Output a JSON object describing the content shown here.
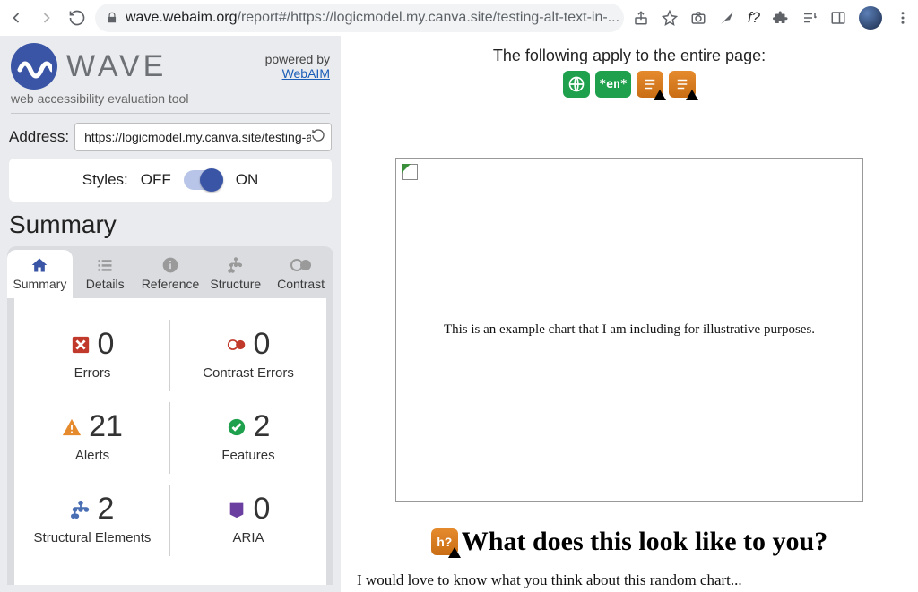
{
  "browser": {
    "url_domain": "wave.webaim.org",
    "url_path": "/report#/https://logicmodel.my.canva.site/testing-alt-text-in-..."
  },
  "sidebar": {
    "brand": "WAVE",
    "powered_label": "powered by",
    "powered_link": "WebAIM",
    "tagline": "web accessibility evaluation tool",
    "address_label": "Address:",
    "address_value": "https://logicmodel.my.canva.site/testing-alt-",
    "styles": {
      "label": "Styles:",
      "off": "OFF",
      "on": "ON",
      "state": "on"
    },
    "heading": "Summary",
    "tabs": [
      {
        "label": "Summary"
      },
      {
        "label": "Details"
      },
      {
        "label": "Reference"
      },
      {
        "label": "Structure"
      },
      {
        "label": "Contrast"
      }
    ],
    "stats": {
      "errors": {
        "value": "0",
        "label": "Errors"
      },
      "contrast": {
        "value": "0",
        "label": "Contrast Errors"
      },
      "alerts": {
        "value": "21",
        "label": "Alerts"
      },
      "features": {
        "value": "2",
        "label": "Features"
      },
      "structural": {
        "value": "2",
        "label": "Structural Elements"
      },
      "aria": {
        "value": "0",
        "label": "ARIA"
      }
    }
  },
  "content": {
    "banner": "The following apply to the entire page:",
    "en_badge": "*en*",
    "h_badge": "h?",
    "chart_caption": "This is an example chart that I am including for illustrative purposes.",
    "heading": "What does this look like to you?",
    "body": "I would love to know what you think about this random chart..."
  }
}
